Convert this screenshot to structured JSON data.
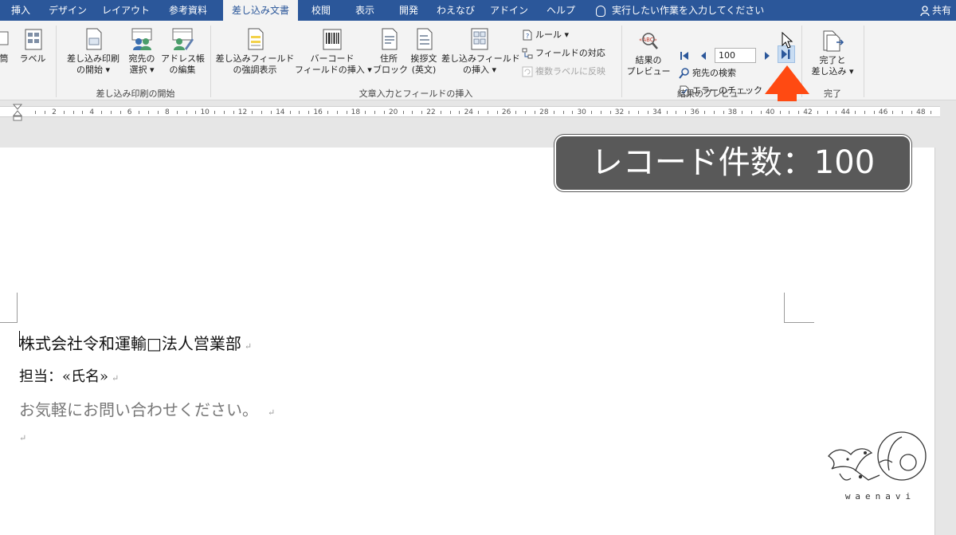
{
  "tabs": {
    "insert": "挿入",
    "design": "デザイン",
    "layout": "レイアウト",
    "references": "参考資料",
    "mailings": "差し込み文書",
    "review": "校閲",
    "view": "表示",
    "developer": "開発",
    "waenavi": "わえなび",
    "addins": "アドイン",
    "help": "ヘルプ"
  },
  "tell_me": "実行したい作業を入力してください",
  "share": "共有",
  "ribbon": {
    "envelopes_partial": "筒",
    "labels": "ラベル",
    "start_mail_merge": [
      "差し込み印刷",
      "の開始 ▾"
    ],
    "select_recipients": [
      "宛先の",
      "選択 ▾"
    ],
    "edit_recipients": [
      "アドレス帳",
      "の編集"
    ],
    "group_start": "差し込み印刷の開始",
    "highlight_fields": [
      "差し込みフィールド",
      "の強調表示"
    ],
    "barcode_field": [
      "バーコード",
      "フィールドの挿入 ▾"
    ],
    "address_block": [
      "住所",
      "ブロック"
    ],
    "greeting_line": [
      "挨拶文",
      "(英文)"
    ],
    "insert_merge_field": [
      "差し込みフィールド",
      "の挿入 ▾"
    ],
    "rules": "ルール ▾",
    "match_fields": "フィールドの対応",
    "update_labels": "複数ラベルに反映",
    "group_write": "文章入力とフィールドの挿入",
    "preview_results": [
      "結果の",
      "プレビュー"
    ],
    "record_value": "100",
    "find_recipient": "宛先の検索",
    "check_errors": "エラーのチェック",
    "group_preview": "結果のプレビュー",
    "finish_merge": [
      "完了と",
      "差し込み ▾"
    ],
    "group_finish": "完了"
  },
  "ruler_numbers": [
    "2",
    "4",
    "6",
    "8",
    "10",
    "12",
    "14",
    "16",
    "18",
    "20",
    "22",
    "24",
    "26",
    "28",
    "30",
    "32",
    "34",
    "36",
    "38",
    "40",
    "42",
    "44",
    "46",
    "48"
  ],
  "document": {
    "line1": "株式会社令和運輸□法人営業部",
    "line2": "担当：«氏名»",
    "line3": "お気軽にお問い合わせください。",
    "para_mark": "↵"
  },
  "callout": "レコード件数：100",
  "logo_text": "waenavi",
  "colors": {
    "accent": "#2b579a",
    "arrow": "#ff4a12",
    "callout_bg": "#595959"
  }
}
